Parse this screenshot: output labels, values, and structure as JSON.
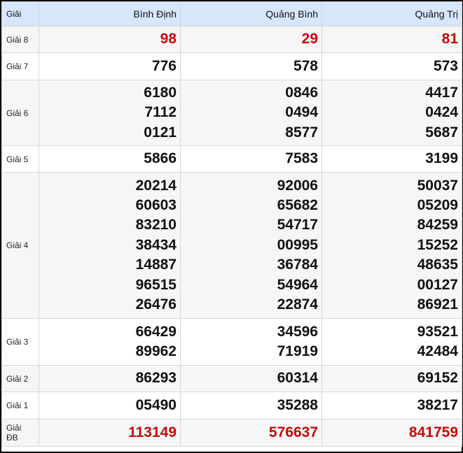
{
  "header": {
    "label": "Giải",
    "provinces": [
      "Bình Định",
      "Quảng Bình",
      "Quảng Trị"
    ]
  },
  "rows": [
    {
      "name": "Giải 8",
      "values": [
        [
          "98"
        ],
        [
          "29"
        ],
        [
          "81"
        ]
      ]
    },
    {
      "name": "Giải 7",
      "values": [
        [
          "776"
        ],
        [
          "578"
        ],
        [
          "573"
        ]
      ]
    },
    {
      "name": "Giải 6",
      "values": [
        [
          "6180",
          "7112",
          "0121"
        ],
        [
          "0846",
          "0494",
          "8577"
        ],
        [
          "4417",
          "0424",
          "5687"
        ]
      ]
    },
    {
      "name": "Giải 5",
      "values": [
        [
          "5866"
        ],
        [
          "7583"
        ],
        [
          "3199"
        ]
      ]
    },
    {
      "name": "Giải 4",
      "values": [
        [
          "20214",
          "60603",
          "83210",
          "38434",
          "14887",
          "96515",
          "26476"
        ],
        [
          "92006",
          "65682",
          "54717",
          "00995",
          "36784",
          "54964",
          "22874"
        ],
        [
          "50037",
          "05209",
          "84259",
          "15252",
          "48635",
          "00127",
          "86921"
        ]
      ]
    },
    {
      "name": "Giải 3",
      "values": [
        [
          "66429",
          "89962"
        ],
        [
          "34596",
          "71919"
        ],
        [
          "93521",
          "42484"
        ]
      ]
    },
    {
      "name": "Giải 2",
      "values": [
        [
          "86293"
        ],
        [
          "60314"
        ],
        [
          "69152"
        ]
      ]
    },
    {
      "name": "Giải 1",
      "values": [
        [
          "05490"
        ],
        [
          "35288"
        ],
        [
          "38217"
        ]
      ]
    },
    {
      "name": "Giải ĐB",
      "values": [
        [
          "113149"
        ],
        [
          "576637"
        ],
        [
          "841759"
        ]
      ]
    }
  ],
  "colors": {
    "header_bg": "#d6e6fb",
    "highlight_red": "#c80a0a",
    "alt_row_bg": "#f6f6f6"
  }
}
